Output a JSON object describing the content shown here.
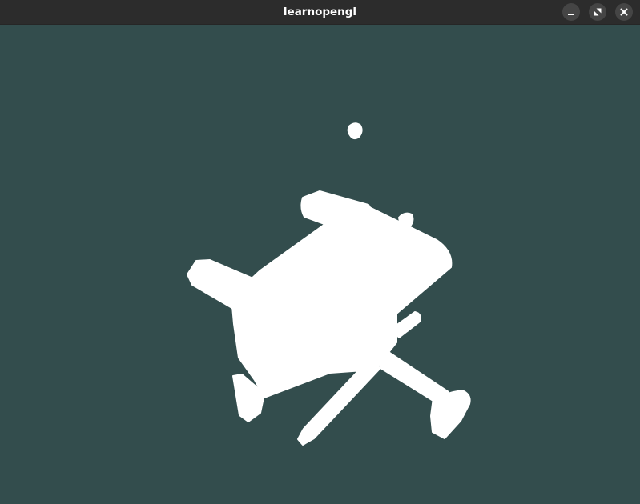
{
  "window": {
    "title": "learnopengl",
    "controls": {
      "minimize_icon": "minimize-icon",
      "maximize_icon": "maximize-icon",
      "close_icon": "close-icon"
    }
  },
  "viewport": {
    "clear_color": "#334d4d",
    "model_color": "#ffffff"
  }
}
